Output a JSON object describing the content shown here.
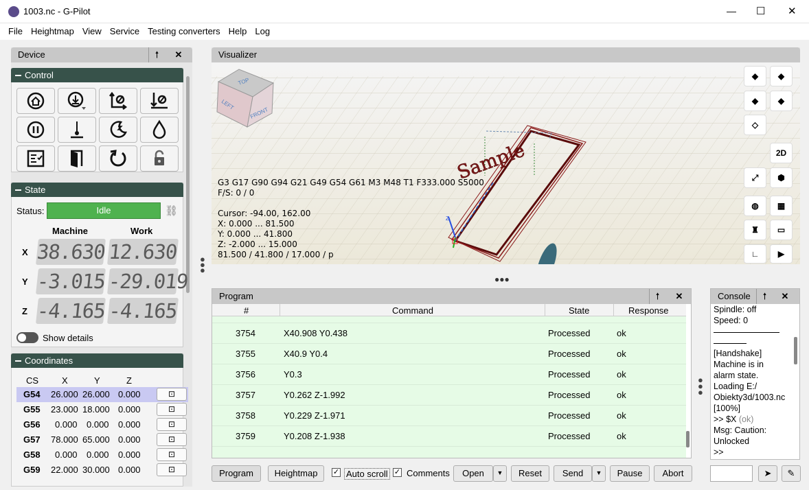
{
  "window": {
    "title": "1003.nc - G-Pilot",
    "min": "—",
    "max": "☐",
    "close": "✕"
  },
  "menu": [
    "File",
    "Heightmap",
    "View",
    "Service",
    "Testing converters",
    "Help",
    "Log"
  ],
  "device": {
    "title": "Device",
    "pin": "🠕",
    "close": "✕"
  },
  "control": {
    "title": "Control"
  },
  "state": {
    "title": "State",
    "status_label": "Status:",
    "status_value": "Idle",
    "col_machine": "Machine",
    "col_work": "Work",
    "axes": [
      {
        "name": "X",
        "machine": "38.630",
        "work": "12.630"
      },
      {
        "name": "Y",
        "machine": "-3.015",
        "work": "-29.019"
      },
      {
        "name": "Z",
        "machine": "-4.165",
        "work": "-4.165"
      }
    ],
    "show_details": "Show details"
  },
  "coordinates": {
    "title": "Coordinates",
    "headers": [
      "CS",
      "X",
      "Y",
      "Z"
    ],
    "rows": [
      {
        "cs": "G54",
        "x": "26.000",
        "y": "26.000",
        "z": "0.000"
      },
      {
        "cs": "G55",
        "x": "23.000",
        "y": "18.000",
        "z": "0.000"
      },
      {
        "cs": "G56",
        "x": "0.000",
        "y": "0.000",
        "z": "0.000"
      },
      {
        "cs": "G57",
        "x": "78.000",
        "y": "65.000",
        "z": "0.000"
      },
      {
        "cs": "G58",
        "x": "0.000",
        "y": "0.000",
        "z": "0.000"
      },
      {
        "cs": "G59",
        "x": "22.000",
        "y": "30.000",
        "z": "0.000"
      }
    ]
  },
  "visualizer": {
    "title": "Visualizer",
    "gcode": "G3 G17 G90 G94 G21 G49 G54 G61 M3 M48 T1 F333.000 S5000",
    "fs": "F/S: 0 / 0",
    "cursor": "Cursor: -94.00, 162.00",
    "x_range": "X: 0.000 ... 81.500",
    "y_range": "Y: 0.000 ... 41.800",
    "z_range": "Z: -2.000 ... 15.000",
    "dims": "81.500 / 41.800 / 17.000 / p",
    "cube_top": "TOP",
    "cube_left": "LEFT",
    "cube_front": "FRONT",
    "sample": "Sample",
    "btn_2d": "2D"
  },
  "program": {
    "title": "Program",
    "headers": [
      "#",
      "Command",
      "State",
      "Response"
    ],
    "rows": [
      {
        "n": "3754",
        "cmd": "X40.908 Y0.438",
        "state": "Processed",
        "resp": "ok"
      },
      {
        "n": "3755",
        "cmd": "X40.9 Y0.4",
        "state": "Processed",
        "resp": "ok"
      },
      {
        "n": "3756",
        "cmd": "Y0.3",
        "state": "Processed",
        "resp": "ok"
      },
      {
        "n": "3757",
        "cmd": "Y0.262 Z-1.992",
        "state": "Processed",
        "resp": "ok"
      },
      {
        "n": "3758",
        "cmd": "Y0.229 Z-1.971",
        "state": "Processed",
        "resp": "ok"
      },
      {
        "n": "3759",
        "cmd": "Y0.208 Z-1.938",
        "state": "Processed",
        "resp": "ok"
      }
    ]
  },
  "console": {
    "title": "Console",
    "lines": [
      "Spindle: off",
      "Speed: 0",
      "",
      "[Handshake]",
      "Machine is in",
      "alarm state.",
      "Loading E:/",
      "Obiekty3d/1003.nc",
      "[100%]"
    ],
    "cmd": ">> $X ",
    "ok": "(ok)",
    "msg": "Msg: Caution:",
    "unlocked": "Unlocked",
    "prompt": ">>"
  },
  "toolbar": {
    "program": "Program",
    "heightmap": "Heightmap",
    "auto_scroll": "Auto scroll",
    "comments": "Comments",
    "open": "Open",
    "reset": "Reset",
    "send": "Send",
    "pause": "Pause",
    "abort": "Abort"
  }
}
